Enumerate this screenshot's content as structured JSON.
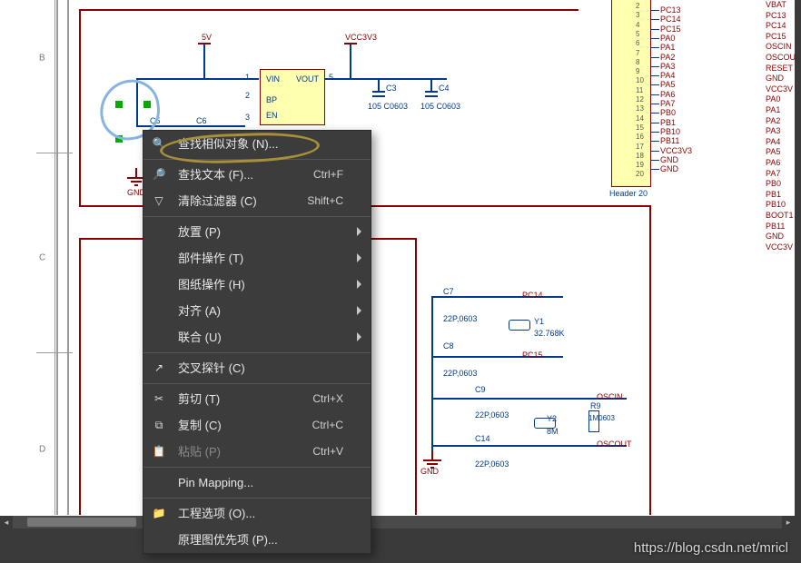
{
  "ruler": {
    "B": "B",
    "C": "C",
    "D": "D"
  },
  "power": {
    "v5": "5V",
    "vcc": "VCC3V3"
  },
  "chip": {
    "vin": "VIN",
    "vout": "VOUT",
    "bp": "BP",
    "en": "EN",
    "p1": "1",
    "p2": "2",
    "p3": "3",
    "p5": "5"
  },
  "caps": {
    "c3": "C3",
    "c3v": "105 C0603",
    "c4": "C4",
    "c4v": "105 C0603",
    "c5": "C5",
    "c6": "C6",
    "c7": "C7",
    "c7v": "22P,0603",
    "c8": "C8",
    "c8v": "22P,0603",
    "c9": "C9",
    "c9v": "22P,0603",
    "c14": "C14",
    "c14v": "22P,0603"
  },
  "xt": {
    "y1": "Y1",
    "y1v": "32.768K",
    "y2": "Y2",
    "y2v": "8M",
    "r9": "R9",
    "r9v": "1M0603"
  },
  "gnd": "GND",
  "osc": {
    "pc14": "PC14",
    "pc15": "PC15",
    "in": "OSCIN",
    "out": "OSCOUT"
  },
  "headerLabel": "Header 20",
  "headerLeft": [
    "PC13",
    "PC14",
    "PC15",
    "PA0",
    "PA1",
    "PA2",
    "PA3",
    "PA4",
    "PA5",
    "PA6",
    "PA7",
    "PB0",
    "PB1",
    "PB10",
    "PB11",
    "VCC3V3",
    "GND",
    "GND"
  ],
  "headerRight": [
    "VBAT",
    "PC13",
    "PC14",
    "PC15",
    "OSCIN",
    "OSCOU",
    "RESET",
    "GND",
    "VCC3V",
    "PA0",
    "PA1",
    "PA2",
    "PA3",
    "PA4",
    "PA5",
    "PA6",
    "PA7",
    "PB0",
    "PB1",
    "PB10",
    "BOOT1",
    "PB11",
    "GND",
    "VCC3V"
  ],
  "headerNums": [
    "2",
    "3",
    "4",
    "5",
    "6",
    "7",
    "8",
    "9",
    "10",
    "11",
    "12",
    "13",
    "14",
    "15",
    "16",
    "17",
    "18",
    "19",
    "20"
  ],
  "menu": {
    "findSimilar": "查找相似对象 (N)...",
    "findText": "查找文本 (F)...",
    "findTextSc": "Ctrl+F",
    "clearFilter": "清除过滤器 (C)",
    "clearFilterSc": "Shift+C",
    "place": "放置 (P)",
    "partOps": "部件操作 (T)",
    "sheetOps": "图纸操作 (H)",
    "align": "对齐 (A)",
    "union": "联合 (U)",
    "crossProbe": "交叉探针 (C)",
    "cut": "剪切 (T)",
    "cutSc": "Ctrl+X",
    "copy": "复制 (C)",
    "copySc": "Ctrl+C",
    "paste": "粘贴 (P)",
    "pasteSc": "Ctrl+V",
    "pinMapping": "Pin Mapping...",
    "projOpts": "工程选项 (O)...",
    "schPrefs": "原理图优先项 (P)..."
  },
  "watermark": "https://blog.csdn.net/mricl"
}
